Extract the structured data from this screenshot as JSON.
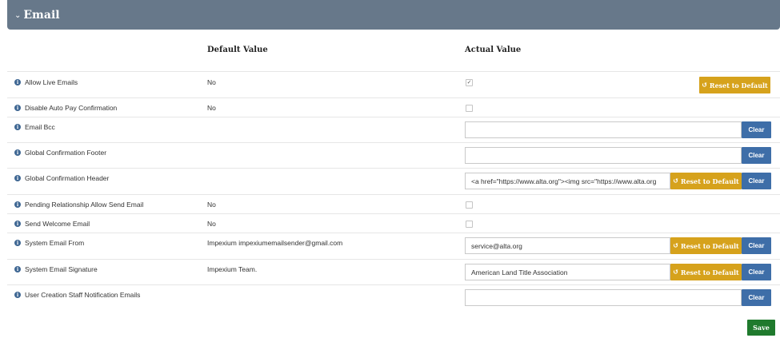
{
  "section": {
    "title": "Email",
    "toggle_icon": "chevron-down-icon"
  },
  "columns": {
    "default": "Default Value",
    "actual": "Actual Value"
  },
  "buttons": {
    "reset": "Reset to Default",
    "clear": "Clear",
    "save": "Save"
  },
  "colors": {
    "header": "#67788a",
    "clear": "#3e6ea8",
    "reset": "#d6a21c",
    "save": "#1f7a2d",
    "info": "#3f6793"
  },
  "settings": [
    {
      "label": "Allow Live Emails",
      "default": "No",
      "type": "checkbox",
      "checked": true,
      "reset": true
    },
    {
      "label": "Disable Auto Pay Confirmation",
      "default": "No",
      "type": "checkbox",
      "checked": false
    },
    {
      "label": "Email Bcc",
      "default": "",
      "type": "text",
      "value": ""
    },
    {
      "label": "Global Confirmation Footer",
      "default": "",
      "type": "text",
      "value": ""
    },
    {
      "label": "Global Confirmation Header",
      "default": "",
      "type": "text",
      "value": "<a href=\"https://www.alta.org\"><img src=\"https://www.alta.org",
      "reset": true
    },
    {
      "label": "Pending Relationship Allow Send Email",
      "default": "No",
      "type": "checkbox",
      "checked": false
    },
    {
      "label": "Send Welcome Email",
      "default": "No",
      "type": "checkbox",
      "checked": false
    },
    {
      "label": "System Email From",
      "default": "Impexium impexiumemailsender@gmail.com",
      "type": "text",
      "value": "service@alta.org",
      "reset": true
    },
    {
      "label": "System Email Signature",
      "default": "Impexium Team.",
      "type": "text",
      "value": "American Land Title Association",
      "reset": true
    },
    {
      "label": "User Creation Staff Notification Emails",
      "default": "",
      "type": "text",
      "value": ""
    }
  ]
}
